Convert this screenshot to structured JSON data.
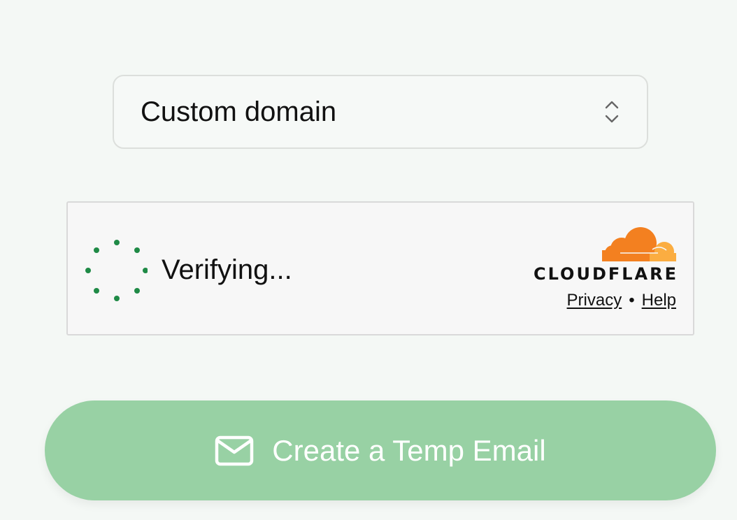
{
  "domain_select": {
    "value": "Custom domain",
    "icon": "chevron-up-down-icon"
  },
  "turnstile": {
    "status_text": "Verifying...",
    "brand_name": "CLOUDFLARE",
    "privacy_link": "Privacy",
    "separator": "•",
    "help_link": "Help",
    "colors": {
      "spinner": "#1f8a46",
      "cloud_primary": "#f38020",
      "cloud_secondary": "#fbad41"
    }
  },
  "create_button": {
    "label": "Create a Temp Email",
    "icon": "envelope-icon",
    "color": "#98d1a4"
  }
}
